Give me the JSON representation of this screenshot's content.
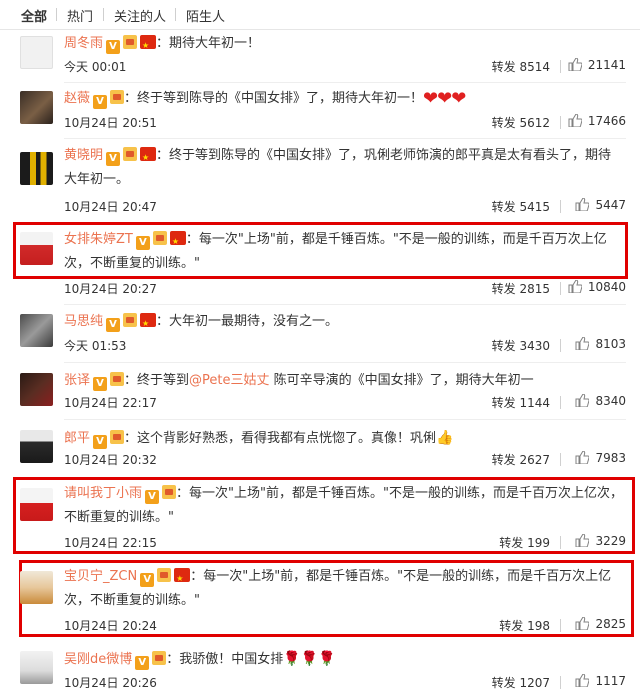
{
  "tabs": [
    "全部",
    "热门",
    "关注的人",
    "陌生人"
  ],
  "comments": [
    {
      "user": "周冬雨",
      "text": "：期待大年初一！",
      "time": "今天 00:01",
      "repost": "转发 8514",
      "likes": "21141"
    },
    {
      "user": "赵薇",
      "text": "：终于等到陈导的《中国女排》了，期待大年初一！",
      "time": "10月24日 20:51",
      "repost": "转发 5612",
      "likes": "17466"
    },
    {
      "user": "黄晓明",
      "text1": "：终于等到陈导的《中国女排》了，巩俐老师饰演的郎平真是太有看头了，期待",
      "text2": "大年初一。",
      "time": "10月24日 20:47",
      "repost": "转发 5415",
      "likes": "5447"
    },
    {
      "user": "女排朱婷ZT",
      "text1": "：每一次\"上场\"前，都是千锤百炼。\"不是一般的训练，而是千百万次上亿",
      "text2": "次，不断重复的训练。\"",
      "time": "10月24日 20:27",
      "repost": "转发 2815",
      "likes": "10840"
    },
    {
      "user": "马思纯",
      "text": "：大年初一最期待，没有之一。",
      "time": "今天 01:53",
      "repost": "转发 3430",
      "likes": "8103"
    },
    {
      "user": "张译",
      "text_pre": "：终于等到",
      "mention": "@Pete三姑丈",
      "text_post": " 陈可辛导演的《中国女排》了，期待大年初一",
      "time": "10月24日 22:17",
      "repost": "转发 1144",
      "likes": "8340"
    },
    {
      "user": "郎平",
      "text": "：这个背影好熟悉，看得我都有点恍惚了。真像！巩俐",
      "time": "10月24日 20:32",
      "repost": "转发 2627",
      "likes": "7983"
    },
    {
      "user": "请叫我丁小雨",
      "text1": "：每一次\"上场\"前，都是千锤百炼。\"不是一般的训练，而是千百万次上亿次，",
      "text2": "不断重复的训练。\"",
      "time": "10月24日 22:15",
      "repost": "转发 199",
      "likes": "3229"
    },
    {
      "user": "宝贝宁_ZCN",
      "text1": "：每一次\"上场\"前，都是千锤百炼。\"不是一般的训练，而是千百万次上亿",
      "text2": "次，不断重复的训练。\"",
      "time": "10月24日 20:24",
      "repost": "转发 198",
      "likes": "2825"
    },
    {
      "user": "吴刚de微博",
      "text": "：我骄傲！中国女排",
      "time": "10月24日 20:26",
      "repost": "转发 1207",
      "likes": "1117"
    }
  ],
  "colors": {
    "username": "#eb7350",
    "highlight": "#e00000",
    "text": "#333333"
  },
  "icons": {
    "like": "thumbs-up-icon",
    "verified": "verified-v-icon",
    "vip": "vip-crown-icon",
    "flag": "china-flag-icon",
    "hearts": "red-hearts-emoji",
    "rose": "rose-emoji",
    "thumb": "thumbs-up-emoji"
  }
}
